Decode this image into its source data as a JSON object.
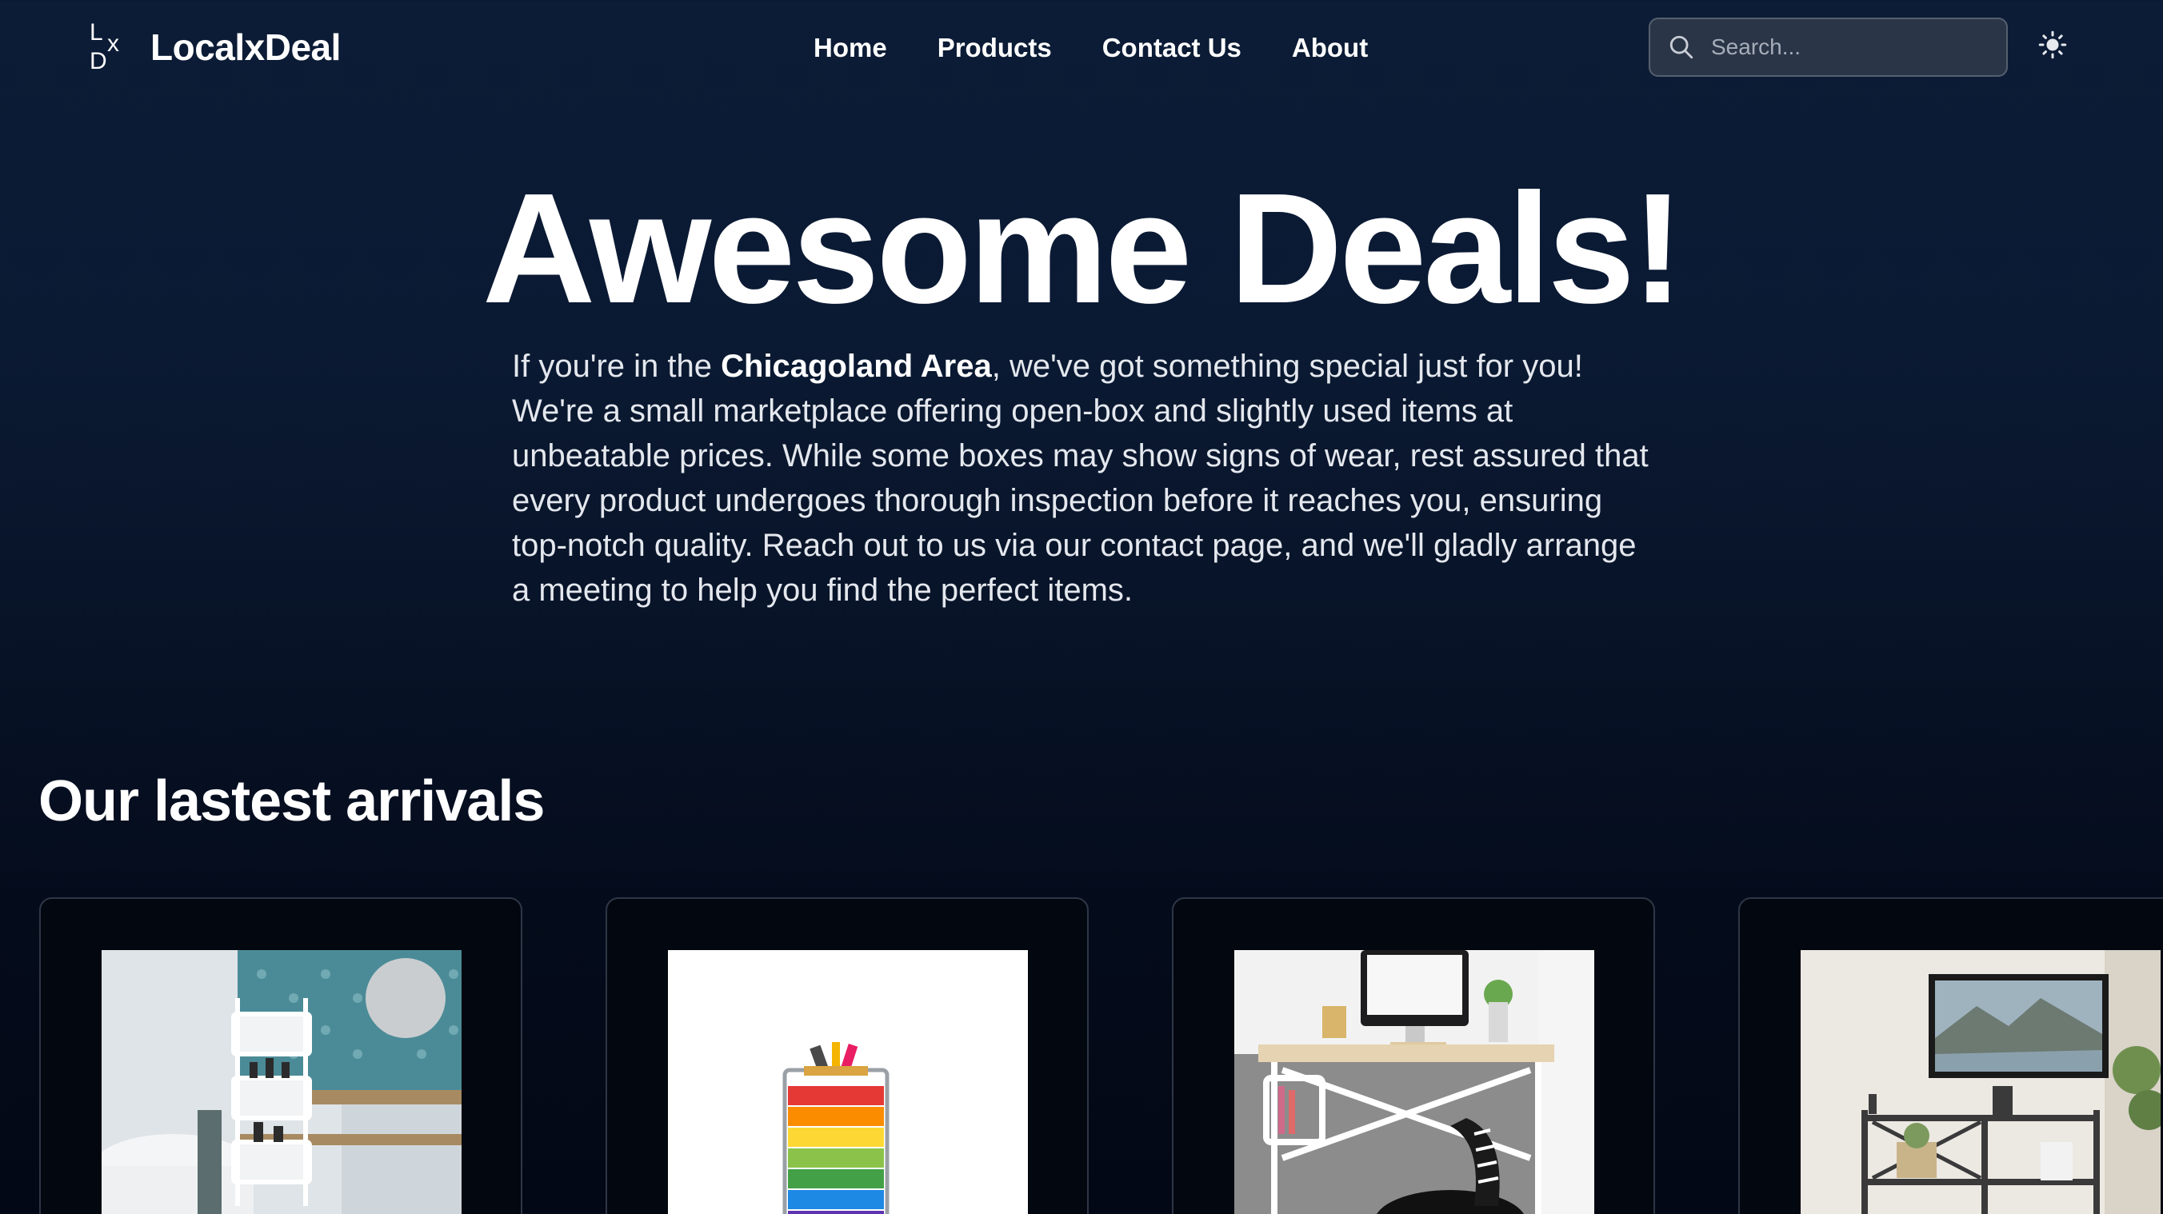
{
  "header": {
    "logo_letters": {
      "l": "L",
      "x": "x",
      "d": "D"
    },
    "brand": "LocalxDeal",
    "nav": [
      "Home",
      "Products",
      "Contact Us",
      "About"
    ],
    "search_placeholder": "Search...",
    "icons": {
      "search": "search-icon",
      "theme": "sun-icon"
    }
  },
  "hero": {
    "title": "Awesome Deals!",
    "intro_before": "If you're in the ",
    "intro_bold": "Chicagoland Area",
    "intro_after": ", we've got something special just for you! We're a small marketplace offering open-box and slightly used items at unbeatable prices. While some boxes may show signs of wear, rest assured that every product undergoes thorough inspection before it reaches you, ensuring top-notch quality. Reach out to us via our contact page, and we'll gladly arrange a meeting to help you find the perfect items."
  },
  "arrivals": {
    "title": "Our lastest arrivals"
  },
  "colors": {
    "background_top": "#0c1c36",
    "background_bottom": "#030816",
    "search_bg": "#2a3547",
    "card_bg": "#03070f",
    "card_border": "#2e3747"
  }
}
